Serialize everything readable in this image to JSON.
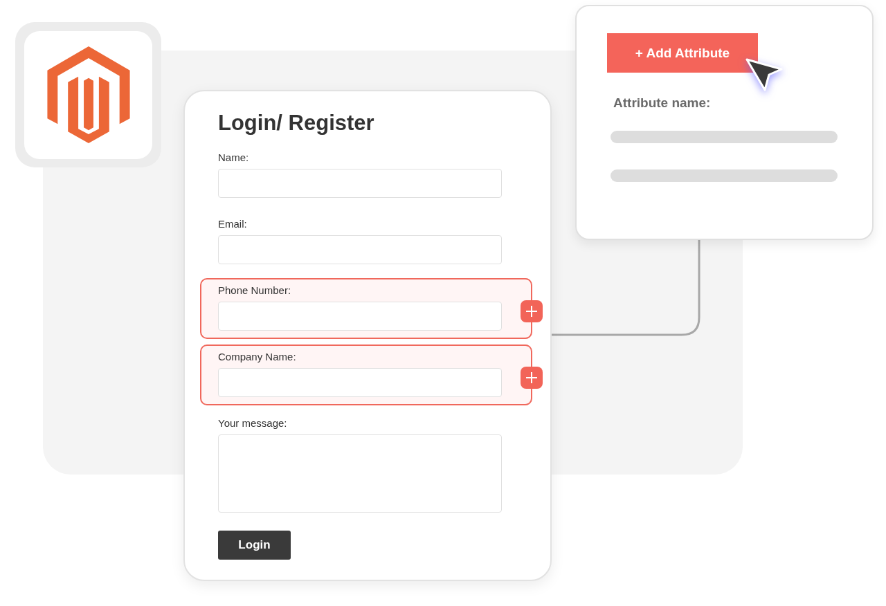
{
  "form": {
    "title": "Login/ Register",
    "fields": [
      {
        "label": "Name:",
        "kind": "input",
        "highlighted": false
      },
      {
        "label": "Email:",
        "kind": "input",
        "highlighted": false
      },
      {
        "label": "Phone Number:",
        "kind": "input",
        "highlighted": true
      },
      {
        "label": "Company Name:",
        "kind": "input",
        "highlighted": true
      },
      {
        "label": "Your message:",
        "kind": "textarea",
        "highlighted": false
      }
    ],
    "button": "Login"
  },
  "attribute_panel": {
    "button": "+ Add Attribute",
    "label": "Attribute name:"
  }
}
